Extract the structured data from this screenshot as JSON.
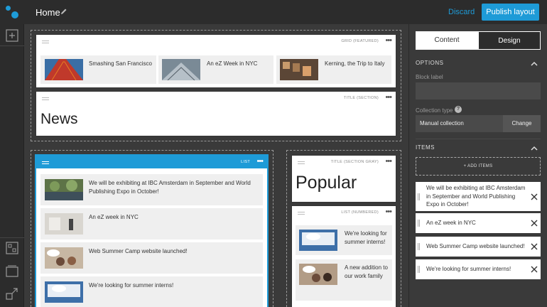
{
  "header": {
    "title": "Home",
    "discard_label": "Discard",
    "publish_label": "Publish layout"
  },
  "colors": {
    "accent": "#1e9bd7",
    "dark_bg": "#2c2c2c",
    "canvas_bg": "#3a3a3a"
  },
  "blocks": {
    "grid_featured": {
      "type_label": "GRID (FEATURED)",
      "items": [
        {
          "title": "Smashing San Francisco"
        },
        {
          "title": "An eZ Week in NYC"
        },
        {
          "title": "Kerning, the Trip to Italy"
        }
      ]
    },
    "title_section": {
      "type_label": "TITLE (SECTION)",
      "title": "News"
    },
    "list": {
      "type_label": "LIST",
      "items": [
        {
          "title": "We will be exhibiting at IBC Amsterdam in September and World Publishing Expo in October!"
        },
        {
          "title": "An eZ week in NYC"
        },
        {
          "title": "Web Summer Camp website launched!"
        },
        {
          "title": "We're looking for summer interns!"
        }
      ]
    },
    "title_section_gray": {
      "type_label": "TITLE (SECTION GRAY)",
      "title": "Popular"
    },
    "list_numbered": {
      "type_label": "LIST (NUMBERED)",
      "items": [
        {
          "title": "We're looking for summer interns!"
        },
        {
          "title": "A new addition to our work family"
        }
      ]
    }
  },
  "panel": {
    "tabs": [
      "Content",
      "Design"
    ],
    "options_label": "OPTIONS",
    "block_label_field": "Block label",
    "block_label_value": "",
    "collection_type_label": "Collection type",
    "collection_type_value": "Manual collection",
    "change_label": "Change",
    "items_label": "ITEMS",
    "add_items_label": "+ ADD ITEMS",
    "items": [
      {
        "title": "We will be exhibiting at IBC Amsterdam in September and World Publishing Expo in October!"
      },
      {
        "title": "An eZ week in NYC"
      },
      {
        "title": "Web Summer Camp website launched!"
      },
      {
        "title": "We're looking for summer interns!"
      }
    ]
  }
}
